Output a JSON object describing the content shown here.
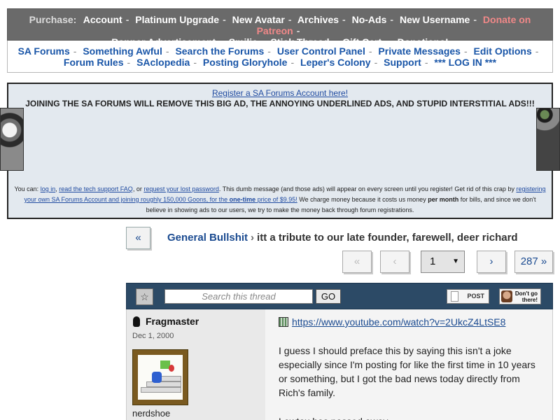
{
  "purchase": {
    "label": "Purchase:",
    "links": [
      "Account",
      "Platinum Upgrade",
      "New Avatar",
      "Archives",
      "No-Ads",
      "New Username",
      "Donate on Patreon",
      "Banner Advertisement",
      "Smilie",
      "Stick Thread",
      "Gift Cert.",
      "Donations!"
    ],
    "sep": "-"
  },
  "nav": {
    "links": [
      "SA Forums",
      "Something Awful",
      "Search the Forums",
      "User Control Panel",
      "Private Messages",
      "Edit Options",
      "Forum Rules",
      "SAclopedia",
      "Posting Gloryhole",
      "Leper's Colony",
      "Support",
      "*** LOG IN ***"
    ],
    "sep": "-"
  },
  "ad": {
    "register_link": "Register a SA Forums Account here!",
    "headline": "JOINING THE SA FORUMS WILL REMOVE THIS BIG AD, THE ANNOYING UNDERLINED ADS, AND STUPID INTERSTITIAL ADS!!!",
    "you_can": "You can:",
    "log_in": "log in",
    "comma": ",",
    "faq": "read the tech support FAQ",
    "or": ", or",
    "lost_pw": "request your lost password",
    "msg1": ". This dumb message (and those ads) will appear on every screen until you register! Get rid of this crap by",
    "register_own": "registering your own SA Forums Account and joining roughly 150,000 Goons, for the",
    "one_time": "one-time",
    "price": "price of $9.95!",
    "msg2": "We charge money because it costs us money",
    "per_month": "per month",
    "msg3": "for bills, and since we don't believe in showing ads to our users, we try to make the money back through forum registrations."
  },
  "breadcrumb": {
    "back": "«",
    "forum": "General Bullshit",
    "arrow": "›",
    "thread": "itt a tribute to our late founder, farewell, deer richard"
  },
  "pager": {
    "first": "«",
    "prev": "‹",
    "current": "1",
    "caret": "▼",
    "next": "›",
    "last": "287 »"
  },
  "toolbar": {
    "bookmark": "☆",
    "search_placeholder": "Search this thread",
    "go": "GO",
    "post": "POST",
    "dontgo": "Don't go there!"
  },
  "post": {
    "username": "Fragmaster",
    "regdate": "Dec 1, 2000",
    "user_title": "nerdshoe",
    "link": "https://www.youtube.com/watch?v=2UkcZ4LtSE8",
    "paragraph1": "I guess I should preface this by saying this isn't a joke especially since I'm posting for like the first time in 10 years or something, but I got the bad news today directly from Rich's family.",
    "paragraph2": "Lowtax has passed away."
  }
}
